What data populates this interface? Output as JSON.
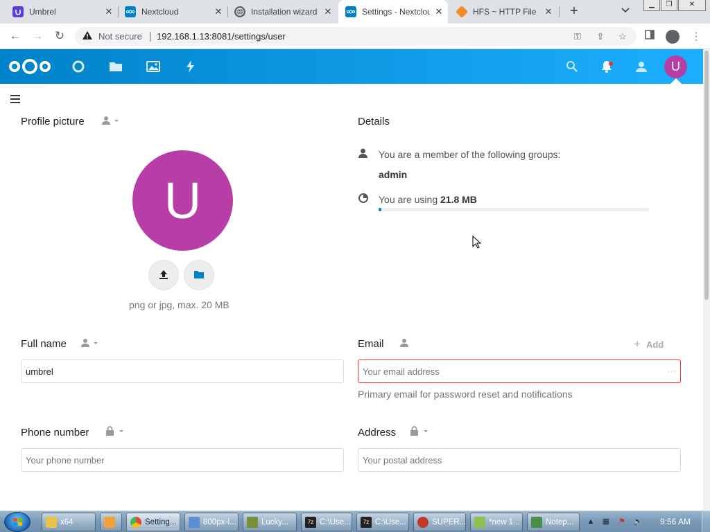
{
  "browser": {
    "tabs": [
      {
        "title": "Umbrel",
        "icon": "umbrel-icon",
        "active": false
      },
      {
        "title": "Nextcloud",
        "icon": "nextcloud-icon",
        "active": false
      },
      {
        "title": "Installation wizard",
        "icon": "globe-icon",
        "active": false
      },
      {
        "title": "Settings - Nextcloud",
        "icon": "nextcloud-icon",
        "active": true
      },
      {
        "title": "HFS ~ HTTP File Server",
        "icon": "hfs-icon",
        "active": false
      }
    ],
    "new_tab_label": "+",
    "security_label": "Not secure",
    "url": "192.168.1.13:8081/settings/user"
  },
  "nextcloud": {
    "avatar_letter": "U",
    "accent_color": "#0082c9",
    "avatar_color": "#b83ea7"
  },
  "profile": {
    "title": "Profile picture",
    "avatar_letter": "U",
    "hint": "png or jpg, max. 20 MB"
  },
  "details": {
    "title": "Details",
    "groups_text": "You are a member of the following groups:",
    "group_name": "admin",
    "usage_prefix": "You are using",
    "usage_amount": "21.8 MB",
    "usage_fraction": 0.01
  },
  "fields": {
    "full_name": {
      "label": "Full name",
      "value": "umbrel"
    },
    "email": {
      "label": "Email",
      "placeholder": "Your email address",
      "hint": "Primary email for password reset and notifications",
      "add_label": "Add"
    },
    "phone": {
      "label": "Phone number",
      "placeholder": "Your phone number"
    },
    "address": {
      "label": "Address",
      "placeholder": "Your postal address"
    }
  },
  "taskbar": {
    "items": [
      {
        "label": "x64",
        "color": "#e8c24a"
      },
      {
        "label": "",
        "color": "#f1a33a"
      },
      {
        "label": "Setting...",
        "color": "#e04a3a",
        "active": true
      },
      {
        "label": "800px-I...",
        "color": "#5a8ed6"
      },
      {
        "label": "Lucky...",
        "color": "#7a8f3a"
      },
      {
        "label": "C:\\Use...",
        "color": "#222222"
      },
      {
        "label": "C:\\Use...",
        "color": "#222222"
      },
      {
        "label": "SUPER...",
        "color": "#c0392b"
      },
      {
        "label": "*new 1...",
        "color": "#8dbf55"
      },
      {
        "label": "Notep...",
        "color": "#4a8d4a"
      }
    ],
    "clock": "9:56 AM"
  }
}
